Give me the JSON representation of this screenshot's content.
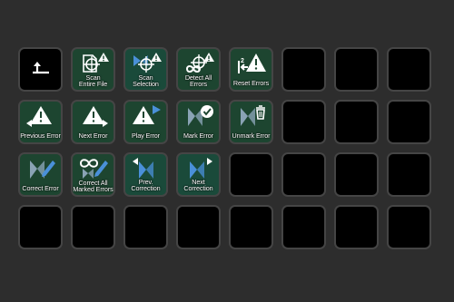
{
  "colors": {
    "background": "#2d2d2d",
    "key_empty": "#000000",
    "key_active": "#1d4530",
    "key_border": "#454545",
    "icon_white": "#ffffff",
    "icon_blue": "#4a90d9"
  },
  "keys": [
    {
      "label": "",
      "icon": "back-arrow-icon"
    },
    {
      "label": "Scan\nEntire File",
      "icon": "scan-file-icon"
    },
    {
      "label": "Scan\nSelection",
      "icon": "scan-selection-icon"
    },
    {
      "label": "Detect All\nErrors",
      "icon": "detect-all-icon"
    },
    {
      "label": "Reset Errors",
      "icon": "reset-errors-icon"
    },
    {
      "label": "Previous Error",
      "icon": "previous-error-icon"
    },
    {
      "label": "Next Error",
      "icon": "next-error-icon"
    },
    {
      "label": "Play Error",
      "icon": "play-error-icon"
    },
    {
      "label": "Mark Error",
      "icon": "mark-error-icon"
    },
    {
      "label": "Unmark Error",
      "icon": "unmark-error-icon"
    },
    {
      "label": "Correct Error",
      "icon": "correct-error-icon"
    },
    {
      "label": "Correct All\nMarked Errors",
      "icon": "correct-all-icon"
    },
    {
      "label": "Prev. Correction",
      "icon": "prev-correction-icon"
    },
    {
      "label": "Next Correction",
      "icon": "next-correction-icon"
    }
  ]
}
